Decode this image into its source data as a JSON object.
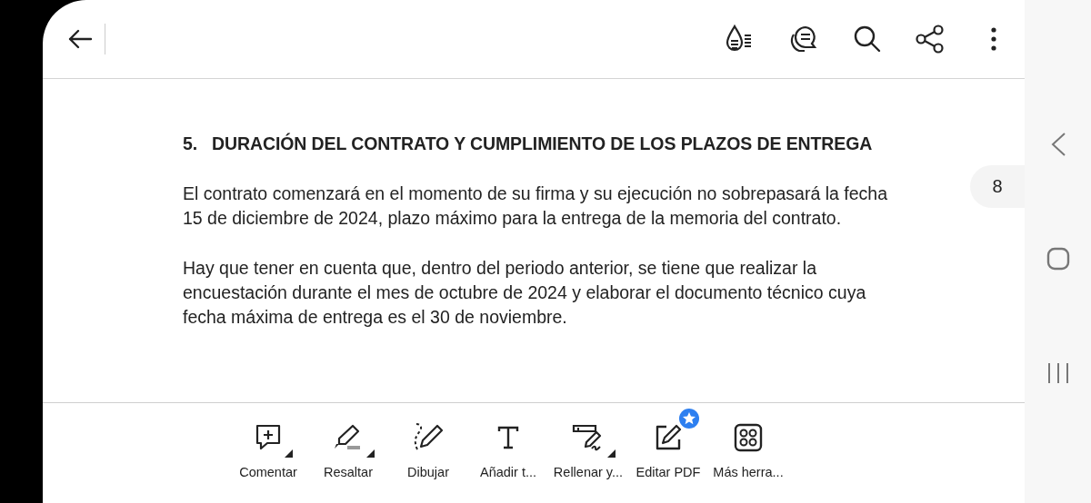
{
  "document": {
    "heading": "5.   DURACIÓN DEL CONTRATO Y CUMPLIMIENTO DE LOS PLAZOS DE ENTREGA",
    "paragraphs": [
      "El contrato comenzará en el momento de su firma y su ejecución no sobrepasará la fecha 15 de diciembre de 2024, plazo máximo para la entrega de la memoria del contrato.",
      "Hay que tener en cuenta que, dentro del periodo anterior, se tiene que realizar la encuestación durante el mes de octubre de 2024 y elaborar el documento técnico cuya fecha máxima de entrega es el 30 de noviembre."
    ]
  },
  "page_number": "8",
  "tools": [
    {
      "kind": "comment",
      "label": "Comentar",
      "menu": true,
      "badge": false
    },
    {
      "kind": "highlight",
      "label": "Resaltar",
      "menu": true,
      "badge": false
    },
    {
      "kind": "draw",
      "label": "Dibujar",
      "menu": false,
      "badge": false
    },
    {
      "kind": "text",
      "label": "Añadir t...",
      "menu": false,
      "badge": false
    },
    {
      "kind": "fill-sign",
      "label": "Rellenar y...",
      "menu": true,
      "badge": false
    },
    {
      "kind": "edit",
      "label": "Editar PDF",
      "menu": false,
      "badge": true
    },
    {
      "kind": "more",
      "label": "Más herra...",
      "menu": false,
      "badge": false
    }
  ]
}
